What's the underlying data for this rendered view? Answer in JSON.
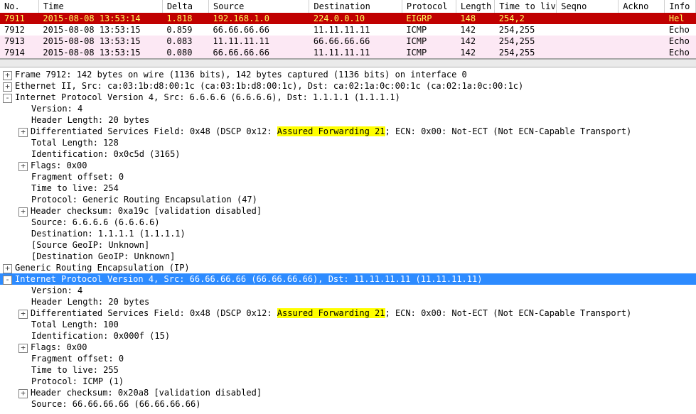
{
  "columns": {
    "no": "No.",
    "time": "Time",
    "delta": "Delta",
    "src": "Source",
    "dst": "Destination",
    "proto": "Protocol",
    "len": "Length",
    "ttl": "Time to live",
    "seq": "Seqno",
    "ack": "Ackno",
    "info": "Info"
  },
  "packets": [
    {
      "no": "7911",
      "time": "2015-08-08 13:53:14",
      "delta": "1.818",
      "src": "192.168.1.0",
      "dst": "224.0.0.10",
      "proto": "EIGRP",
      "len": "148",
      "ttl": "254,2",
      "seq": "",
      "ack": "",
      "info": "Hel"
    },
    {
      "no": "7912",
      "time": "2015-08-08 13:53:15",
      "delta": "0.859",
      "src": "66.66.66.66",
      "dst": "11.11.11.11",
      "proto": "ICMP",
      "len": "142",
      "ttl": "254,255",
      "seq": "",
      "ack": "",
      "info": "Echo"
    },
    {
      "no": "7913",
      "time": "2015-08-08 13:53:15",
      "delta": "0.083",
      "src": "11.11.11.11",
      "dst": "66.66.66.66",
      "proto": "ICMP",
      "len": "142",
      "ttl": "254,255",
      "seq": "",
      "ack": "",
      "info": "Echo"
    },
    {
      "no": "7914",
      "time": "2015-08-08 13:53:15",
      "delta": "0.080",
      "src": "66.66.66.66",
      "dst": "11.11.11.11",
      "proto": "ICMP",
      "len": "142",
      "ttl": "254,255",
      "seq": "",
      "ack": "",
      "info": "Echo"
    }
  ],
  "details": {
    "frame": "Frame 7912: 142 bytes on wire (1136 bits), 142 bytes captured (1136 bits) on interface 0",
    "eth": "Ethernet II, Src: ca:03:1b:d8:00:1c (ca:03:1b:d8:00:1c), Dst: ca:02:1a:0c:00:1c (ca:02:1a:0c:00:1c)",
    "ip_outer": "Internet Protocol Version 4, Src: 6.6.6.6 (6.6.6.6), Dst: 1.1.1.1 (1.1.1.1)",
    "outer": {
      "ver": "Version: 4",
      "hlen": "Header Length: 20 bytes",
      "dsfield_pre": "Differentiated Services Field: 0x48 (DSCP 0x12: ",
      "dsfield_hl": "Assured Forwarding 21",
      "dsfield_post": "; ECN: 0x00: Not-ECT (Not ECN-Capable Transport)",
      "tot": "Total Length: 128",
      "id": "Identification: 0x0c5d (3165)",
      "flags": "Flags: 0x00",
      "frag": "Fragment offset: 0",
      "ttl": "Time to live: 254",
      "proto": "Protocol: Generic Routing Encapsulation (47)",
      "csum": "Header checksum: 0xa19c [validation disabled]",
      "src": "Source: 6.6.6.6 (6.6.6.6)",
      "dst": "Destination: 1.1.1.1 (1.1.1.1)",
      "geoip_src": "[Source GeoIP: Unknown]",
      "geoip_dst": "[Destination GeoIP: Unknown]"
    },
    "gre": "Generic Routing Encapsulation (IP)",
    "ip_inner": "Internet Protocol Version 4, Src: 66.66.66.66 (66.66.66.66), Dst: 11.11.11.11 (11.11.11.11)",
    "inner": {
      "ver": "Version: 4",
      "hlen": "Header Length: 20 bytes",
      "dsfield_pre": "Differentiated Services Field: 0x48 (DSCP 0x12: ",
      "dsfield_hl": "Assured Forwarding 21",
      "dsfield_post": "; ECN: 0x00: Not-ECT (Not ECN-Capable Transport)",
      "tot": "Total Length: 100",
      "id": "Identification: 0x000f (15)",
      "flags": "Flags: 0x00",
      "frag": "Fragment offset: 0",
      "ttl": "Time to live: 255",
      "proto": "Protocol: ICMP (1)",
      "csum": "Header checksum: 0x20a8 [validation disabled]",
      "src": "Source: 66.66.66.66 (66.66.66.66)"
    }
  },
  "toggles": {
    "plus": "+",
    "minus": "-"
  }
}
